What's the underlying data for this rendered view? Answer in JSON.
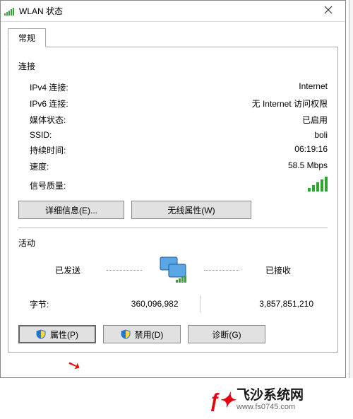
{
  "title": "WLAN 状态",
  "tab": "常规",
  "sections": {
    "connection": {
      "heading": "连接",
      "rows": {
        "ipv4": {
          "label": "IPv4 连接:",
          "value": "Internet"
        },
        "ipv6": {
          "label": "IPv6 连接:",
          "value": "无 Internet 访问权限"
        },
        "media": {
          "label": "媒体状态:",
          "value": "已启用"
        },
        "ssid": {
          "label": "SSID:",
          "value": "boli"
        },
        "dur": {
          "label": "持续时间:",
          "value": "06:19:16"
        },
        "speed": {
          "label": "速度:",
          "value": "58.5 Mbps"
        },
        "signal": {
          "label": "信号质量:"
        }
      },
      "buttons": {
        "details": "详细信息(E)...",
        "wireless": "无线属性(W)"
      }
    },
    "activity": {
      "heading": "活动",
      "sent": "已发送",
      "recv": "已接收",
      "bytes_label": "字节:",
      "bytes_sent": "360,096,982",
      "bytes_recv": "3,857,851,210"
    },
    "actions": {
      "properties": "属性(P)",
      "disable": "禁用(D)",
      "diagnose": "诊断(G)"
    }
  },
  "watermark": {
    "brand": "飞沙系统网",
    "url": "www.fs0745.com"
  }
}
